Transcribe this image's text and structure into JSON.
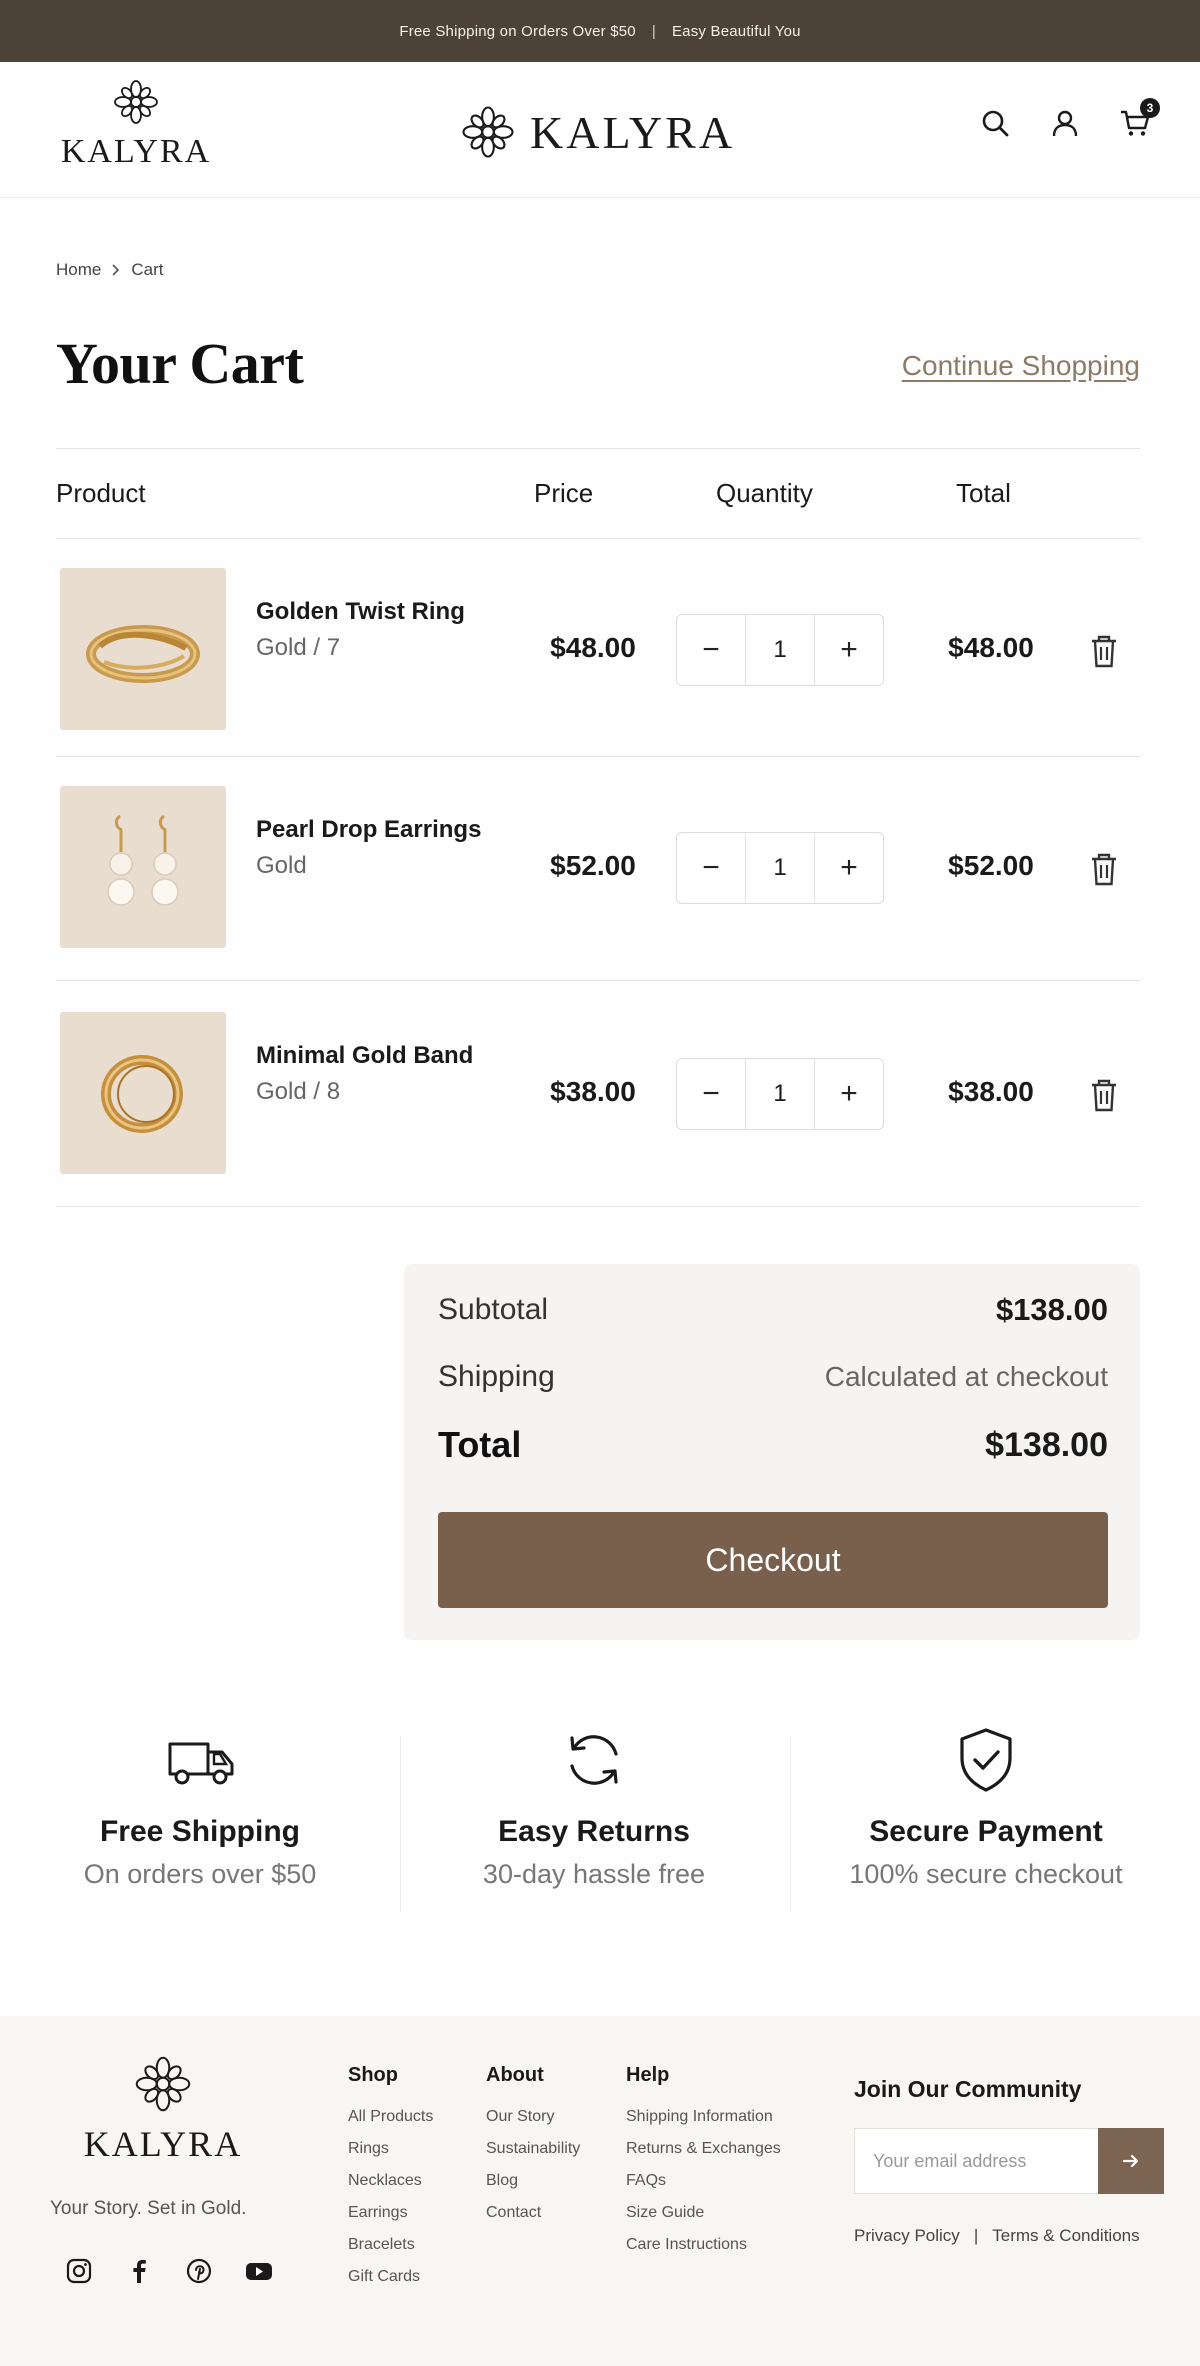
{
  "announcement": {
    "left": "Free Shipping on Orders Over $50",
    "separator": "|",
    "right": "Easy Beautiful You"
  },
  "header": {
    "logo_small": "KALYRA",
    "logo_main": "KALYRA",
    "icons": [
      "search-icon",
      "user-icon",
      "cart-icon"
    ],
    "cart_count": "3"
  },
  "breadcrumb": {
    "home": "Home",
    "current": "Cart"
  },
  "page": {
    "title": "Your Cart",
    "continue_link": "Continue Shopping"
  },
  "table": {
    "headers": {
      "product": "Product",
      "price": "Price",
      "quantity": "Quantity",
      "total": "Total"
    },
    "items": [
      {
        "name": "Golden Twist Ring",
        "variant": "Gold / 7",
        "price": "$48.00",
        "qty": "1",
        "total": "$48.00"
      },
      {
        "name": "Pearl Drop Earrings",
        "variant": "Gold",
        "price": "$52.00",
        "qty": "1",
        "total": "$52.00"
      },
      {
        "name": "Minimal Gold Band",
        "variant": "Gold / 8",
        "price": "$38.00",
        "qty": "1",
        "total": "$38.00"
      }
    ],
    "minus_symbol": "−",
    "plus_symbol": "+"
  },
  "summary": {
    "subtotal_label": "Subtotal",
    "subtotal_value": "$138.00",
    "shipping_label": "Shipping",
    "shipping_value": "Calculated at checkout",
    "total_label": "Total",
    "total_value": "$138.00",
    "checkout_label": "Checkout"
  },
  "features": [
    {
      "icon": "truck-icon",
      "title": "Free Shipping",
      "subtitle": "On orders over $50"
    },
    {
      "icon": "returns-icon",
      "title": "Easy Returns",
      "subtitle": "30-day hassle free"
    },
    {
      "icon": "shield-check-icon",
      "title": "Secure Payment",
      "subtitle": "100% secure checkout"
    }
  ],
  "footer": {
    "logo": "KALYRA",
    "tagline": "Your Story. Set in Gold.",
    "social": [
      "instagram-icon",
      "facebook-icon",
      "pinterest-icon",
      "youtube-icon"
    ],
    "columns": [
      {
        "heading": "Shop",
        "links": [
          "All Products",
          "Rings",
          "Necklaces",
          "Earrings",
          "Bracelets",
          "Gift Cards"
        ]
      },
      {
        "heading": "About",
        "links": [
          "Our Story",
          "Sustainability",
          "Blog",
          "Contact"
        ]
      },
      {
        "heading": "Help",
        "links": [
          "Shipping Information",
          "Returns & Exchanges",
          "FAQs",
          "Size Guide",
          "Care Instructions"
        ]
      }
    ],
    "newsletter_title": "Join Our Community",
    "email_placeholder": "Your email address",
    "privacy": "Privacy Policy",
    "legal_separator": "|",
    "terms": "Terms & Conditions"
  },
  "colors": {
    "announcement_bg": "#4d4238",
    "accent": "#79604c",
    "link": "#8d7b66",
    "summary_bg": "#f5f4f3",
    "footer_bg": "#f8f6f3"
  }
}
